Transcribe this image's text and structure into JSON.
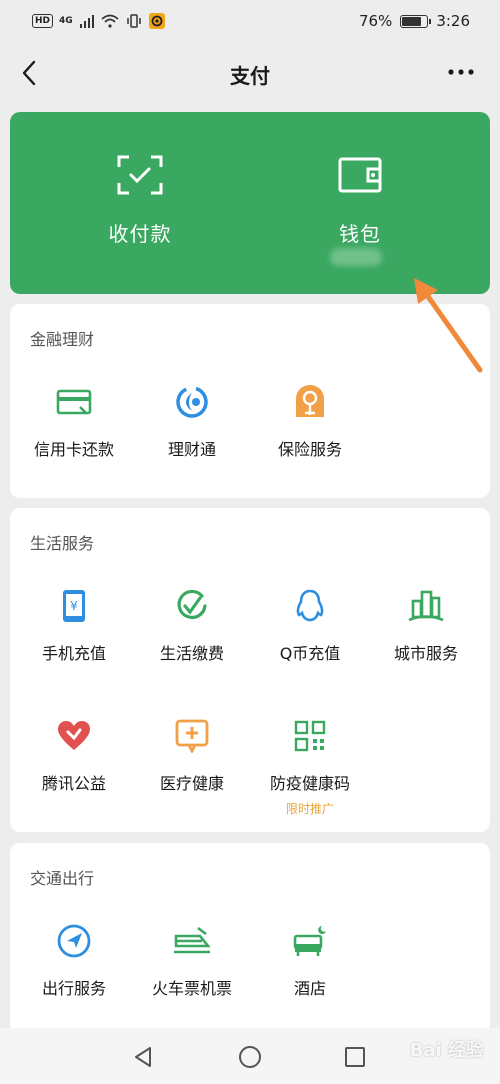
{
  "status_bar": {
    "hd": "HD",
    "network": "4G",
    "battery": "76%",
    "battery_level": 0.76,
    "time": "3:26"
  },
  "nav": {
    "title": "支付",
    "back_icon": "chevron-left-icon",
    "more_icon": "more-dots-icon"
  },
  "wallet_card": {
    "color": "#3aa860",
    "items": [
      {
        "label": "收付款",
        "icon": "scan-frame-icon"
      },
      {
        "label": "钱包",
        "icon": "wallet-icon"
      }
    ]
  },
  "sections": [
    {
      "title": "金融理财",
      "items": [
        {
          "label": "信用卡还款",
          "icon": "credit-card-icon"
        },
        {
          "label": "理财通",
          "icon": "licaitong-icon"
        },
        {
          "label": "保险服务",
          "icon": "insurance-icon"
        }
      ]
    },
    {
      "title": "生活服务",
      "items": [
        {
          "label": "手机充值",
          "icon": "phone-recharge-icon"
        },
        {
          "label": "生活缴费",
          "icon": "utility-payment-icon"
        },
        {
          "label": "Q币充值",
          "icon": "qq-penguin-icon"
        },
        {
          "label": "城市服务",
          "icon": "city-buildings-icon"
        },
        {
          "label": "腾讯公益",
          "icon": "charity-heart-icon"
        },
        {
          "label": "医疗健康",
          "icon": "medical-plus-icon"
        },
        {
          "label": "防疫健康码",
          "icon": "qr-code-icon",
          "sub": "限时推广"
        }
      ]
    },
    {
      "title": "交通出行",
      "items": [
        {
          "label": "出行服务",
          "icon": "navigation-compass-icon"
        },
        {
          "label": "火车票机票",
          "icon": "train-icon"
        },
        {
          "label": "酒店",
          "icon": "hotel-bed-icon"
        }
      ]
    }
  ],
  "bottom_nav": {
    "back": "triangle-back-icon",
    "home": "circle-home-icon",
    "recent": "square-recent-icon"
  },
  "watermark": "Bai 经验"
}
